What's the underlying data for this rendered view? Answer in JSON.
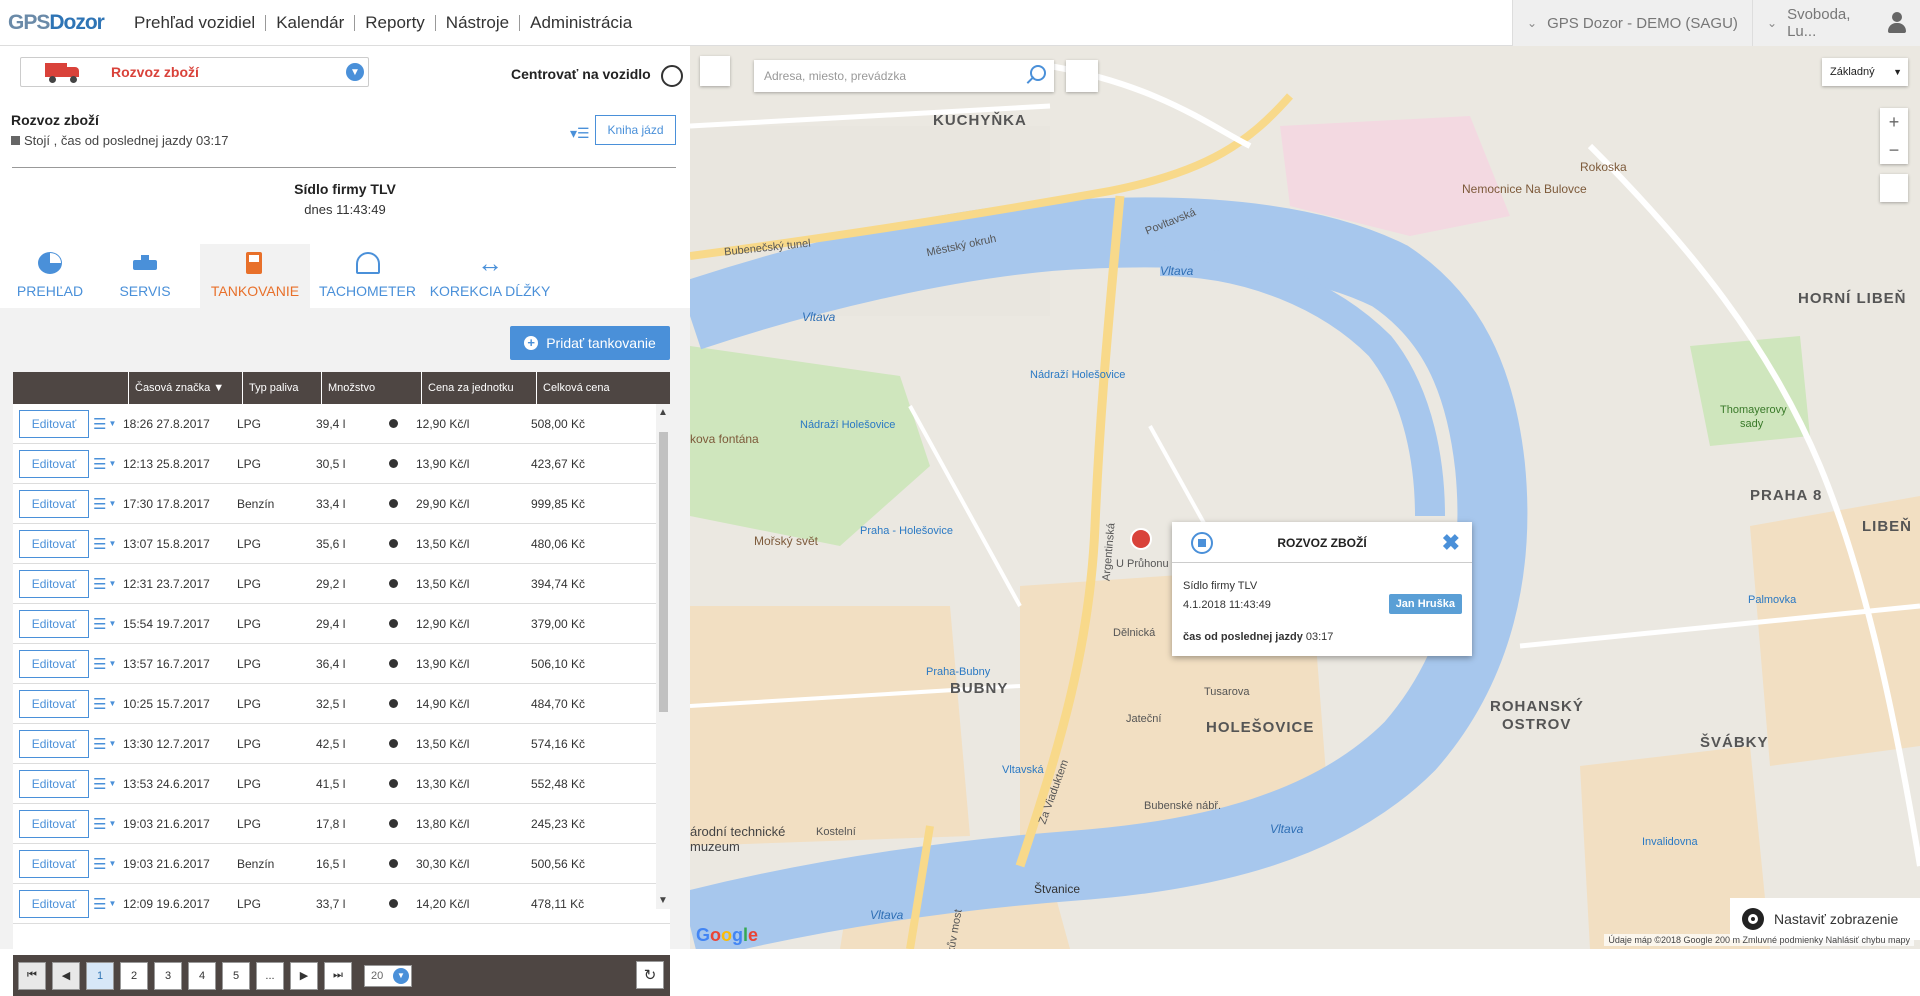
{
  "header": {
    "logo_gps": "GPS",
    "logo_dozor": "Dozor",
    "nav": [
      "Prehľad vozidiel",
      "Kalendár",
      "Reporty",
      "Nástroje",
      "Administrácia"
    ],
    "account": "GPS Dozor - DEMO (SAGU)",
    "user": "Svoboda, Lu..."
  },
  "panel": {
    "vehicle_select": "Rozvoz zboží",
    "center_label": "Centrovať na vozidlo",
    "vehicle_name": "Rozvoz zboží",
    "vehicle_status": "Stojí , čas od poslednej jazdy 03:17",
    "logbook_button": "Kniha jázd",
    "location_name": "Sídlo firmy TLV",
    "location_time": "dnes  11:43:49",
    "tabs": [
      {
        "label": "PREHĽAD",
        "icon": "pie-chart-icon"
      },
      {
        "label": "SERVIS",
        "icon": "oil-can-icon"
      },
      {
        "label": "TANKOVANIE",
        "icon": "fuel-pump-icon"
      },
      {
        "label": "TACHOMETER",
        "icon": "speedometer-icon"
      },
      {
        "label": "KOREKCIA DĹŽKY",
        "icon": "arrows-horizontal-icon"
      }
    ],
    "add_button": "Pridať tankovanie"
  },
  "table": {
    "columns": [
      "Časová značka ▼",
      "Typ paliva",
      "Množstvo",
      "Cena za jednotku",
      "Celková cena"
    ],
    "edit_label": "Editovať",
    "rows": [
      {
        "time": "18:26 27.8.2017",
        "fuel": "LPG",
        "amount": "39,4 l",
        "unit": "12,90 Kč/l",
        "total": "508,00 Kč"
      },
      {
        "time": "12:13 25.8.2017",
        "fuel": "LPG",
        "amount": "30,5 l",
        "unit": "13,90 Kč/l",
        "total": "423,67 Kč"
      },
      {
        "time": "17:30 17.8.2017",
        "fuel": "Benzín",
        "amount": "33,4 l",
        "unit": "29,90 Kč/l",
        "total": "999,85 Kč"
      },
      {
        "time": "13:07 15.8.2017",
        "fuel": "LPG",
        "amount": "35,6 l",
        "unit": "13,50 Kč/l",
        "total": "480,06 Kč"
      },
      {
        "time": "12:31 23.7.2017",
        "fuel": "LPG",
        "amount": "29,2 l",
        "unit": "13,50 Kč/l",
        "total": "394,74 Kč"
      },
      {
        "time": "15:54 19.7.2017",
        "fuel": "LPG",
        "amount": "29,4 l",
        "unit": "12,90 Kč/l",
        "total": "379,00 Kč"
      },
      {
        "time": "13:57 16.7.2017",
        "fuel": "LPG",
        "amount": "36,4 l",
        "unit": "13,90 Kč/l",
        "total": "506,10 Kč"
      },
      {
        "time": "10:25 15.7.2017",
        "fuel": "LPG",
        "amount": "32,5 l",
        "unit": "14,90 Kč/l",
        "total": "484,70 Kč"
      },
      {
        "time": "13:30 12.7.2017",
        "fuel": "LPG",
        "amount": "42,5 l",
        "unit": "13,50 Kč/l",
        "total": "574,16 Kč"
      },
      {
        "time": "13:53 24.6.2017",
        "fuel": "LPG",
        "amount": "41,5 l",
        "unit": "13,30 Kč/l",
        "total": "552,48 Kč"
      },
      {
        "time": "19:03 21.6.2017",
        "fuel": "LPG",
        "amount": "17,8 l",
        "unit": "13,80 Kč/l",
        "total": "245,23 Kč"
      },
      {
        "time": "19:03 21.6.2017",
        "fuel": "Benzín",
        "amount": "16,5 l",
        "unit": "30,30 Kč/l",
        "total": "500,56 Kč"
      },
      {
        "time": "12:09 19.6.2017",
        "fuel": "LPG",
        "amount": "33,7 l",
        "unit": "14,20 Kč/l",
        "total": "478,11 Kč"
      }
    ]
  },
  "pager": {
    "first": "⏮",
    "prev": "◀",
    "pages": [
      "1",
      "2",
      "3",
      "4",
      "5",
      "..."
    ],
    "next": "▶",
    "last": "⏭",
    "page_size": "20",
    "refresh": "↻"
  },
  "map": {
    "search_placeholder": "Adresa, miesto, prevádzka",
    "map_type": "Základný",
    "labels": {
      "kuchynka": "KUCHYŇKA",
      "holesovice": "HOLEŠOVICE",
      "bubny": "BUBNY",
      "horni_liben": "HORNÍ LIBEŇ",
      "liben": "LIBEŇ",
      "praha8": "PRAHA 8",
      "rohansky": "ROHANSKÝ",
      "ostrov": "OSTROV",
      "svabky": "ŠVÁBKY",
      "vltava1": "Vltava",
      "vltava2": "Vltava",
      "vltava3": "Vltava",
      "vltava4": "Vltava",
      "rokoska": "Rokoska",
      "nemocnice": "Nemocnice Na Bulovce",
      "morsky": "Mořský svět",
      "fontana": "kova fontána",
      "nadrazi": "Nádraží Holešovice",
      "nadrazi2": "Nádraží Holešovice",
      "praha_hol": "Praha - Holešovice",
      "praha_bubny": "Praha-Bubny",
      "vltavska": "Vltavská",
      "invalidovna": "Invalidovna",
      "palmovka": "Palmovka",
      "thomayer": "Thomayerovy",
      "sady": "sady",
      "stvanice": "Štvanice",
      "povltavska": "Povltavská",
      "mestsky": "Městský okruh",
      "bubenecsky": "Bubenečský tunel",
      "argentinska": "Argentinská",
      "delnicka": "Dělnická",
      "jatecni": "Jateční",
      "tusarova": "Tusarova",
      "upruhonu": "U Průhonu",
      "zaviaduktem": "Za Viaduktem",
      "muzeum1": "árodní technické",
      "muzeum2": "muzeum",
      "kostelni": "Kostelní",
      "bubenske": "Bubenské nábř.",
      "hlavkuv": "Hlávkův most"
    },
    "popup": {
      "title": "ROZVOZ ZBOŽÍ",
      "place": "Sídlo firmy TLV",
      "datetime": "4.1.2018 11:43:49",
      "driver": "Jan Hruška",
      "last_drive_label": "čas od poslednej jazdy",
      "last_drive_value": "03:17"
    },
    "settings_label": "Nastaviť zobrazenie",
    "footer": "Údaje máp ©2018 Google   200 m   Zmluvné podmienky   Nahlásiť chybu mapy",
    "google": "Google"
  }
}
